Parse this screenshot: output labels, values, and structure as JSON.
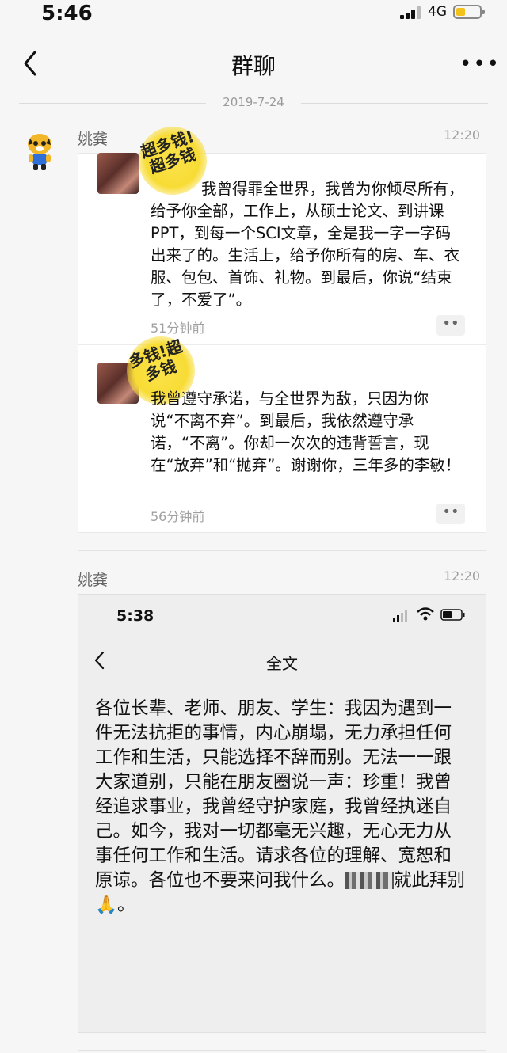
{
  "status_bar": {
    "time": "5:46",
    "network": "4G"
  },
  "nav": {
    "title": "群聊",
    "more": "•••"
  },
  "date_separator": "2019-7-24",
  "messages": [
    {
      "sender": "姚龚",
      "time": "12:20",
      "posts": [
        {
          "sticker": "超多钱!超多钱",
          "text": "我曾得罪全世界，我曾为你倾尽所有，给予你全部，工作上，从硕士论文、到讲课PPT，到每一个SCI文章，全是我一字一字码出来了的。生活上，给予你所有的房、车、衣服、包包、首饰、礼物。到最后，你说“结束了，不爱了”。",
          "time_ago": "51分钟前"
        },
        {
          "sticker": "多钱!超多钱",
          "text": "我曾遵守承诺，与全世界为敌，只因为你说“不离不弃”。到最后，我依然遵守承诺，“不离”。你却一次次的违背誓言，现在“放弃”和“抛弃”。谢谢你，三年多的李敏！",
          "time_ago": "56分钟前"
        }
      ]
    },
    {
      "sender": "姚龚",
      "time": "12:20",
      "screenshot": {
        "time": "5:38",
        "title": "全文",
        "text_before": "各位长辈、老师、朋友、学生：我因为遇到一件无法抗拒的事情，内心崩塌，无力承担任何工作和生活，只能选择不辞而别。无法一一跟大家道别，只能在朋友圈说一声：珍重！我曾经追求事业，我曾经守护家庭，我曾经执迷自己。如今，我对一切都毫无兴趣，无心无力从事任何工作和生活。请求各位的理解、宽恕和原谅。各位也不要来问我什么。",
        "text_after": "就此拜别🙏。"
      }
    }
  ]
}
